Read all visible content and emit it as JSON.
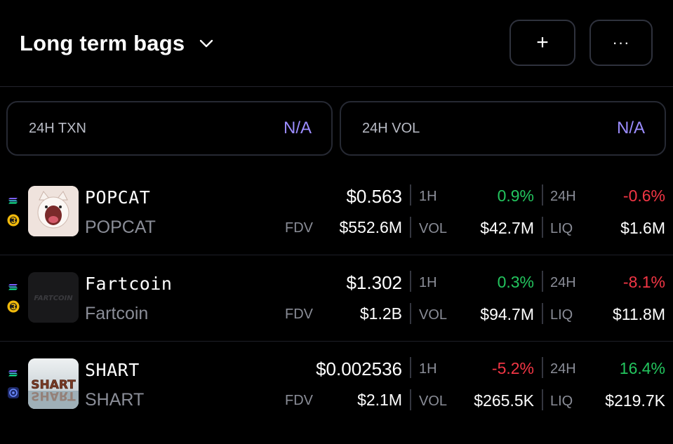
{
  "header": {
    "title": "Long term bags",
    "add_label": "+",
    "more_label": "···"
  },
  "stats": [
    {
      "label": "24H TXN",
      "value": "N/A"
    },
    {
      "label": "24H VOL",
      "value": "N/A"
    }
  ],
  "labels": {
    "fdv": "FDV",
    "h1": "1H",
    "h24": "24H",
    "vol": "VOL",
    "liq": "LIQ"
  },
  "colors": {
    "positive": "#23c55e",
    "negative": "#f23645",
    "accent": "#9b8cff"
  },
  "tokens": [
    {
      "symbol": "POPCAT",
      "name": "POPCAT",
      "logo_text": "",
      "price": "$0.563",
      "fdv": "$552.6M",
      "change_1h": "0.9%",
      "change_1h_dir": "pos",
      "change_24h": "-0.6%",
      "change_24h_dir": "neg",
      "vol": "$42.7M",
      "liq": "$1.6M",
      "chains": [
        "solana-icon",
        "raydium-icon"
      ]
    },
    {
      "symbol": "Fartcoin",
      "name": "Fartcoin",
      "logo_text": "FARTCOIN",
      "price": "$1.302",
      "fdv": "$1.2B",
      "change_1h": "0.3%",
      "change_1h_dir": "pos",
      "change_24h": "-8.1%",
      "change_24h_dir": "neg",
      "vol": "$94.7M",
      "liq": "$11.8M",
      "chains": [
        "solana-icon",
        "raydium-icon"
      ]
    },
    {
      "symbol": "SHART",
      "name": "SHART",
      "logo_text": "SHART",
      "price": "$0.002536",
      "fdv": "$2.1M",
      "change_1h": "-5.2%",
      "change_1h_dir": "neg",
      "change_24h": "16.4%",
      "change_24h_dir": "pos",
      "vol": "$265.5K",
      "liq": "$219.7K",
      "chains": [
        "solana-icon",
        "pumpswap-icon"
      ]
    }
  ]
}
